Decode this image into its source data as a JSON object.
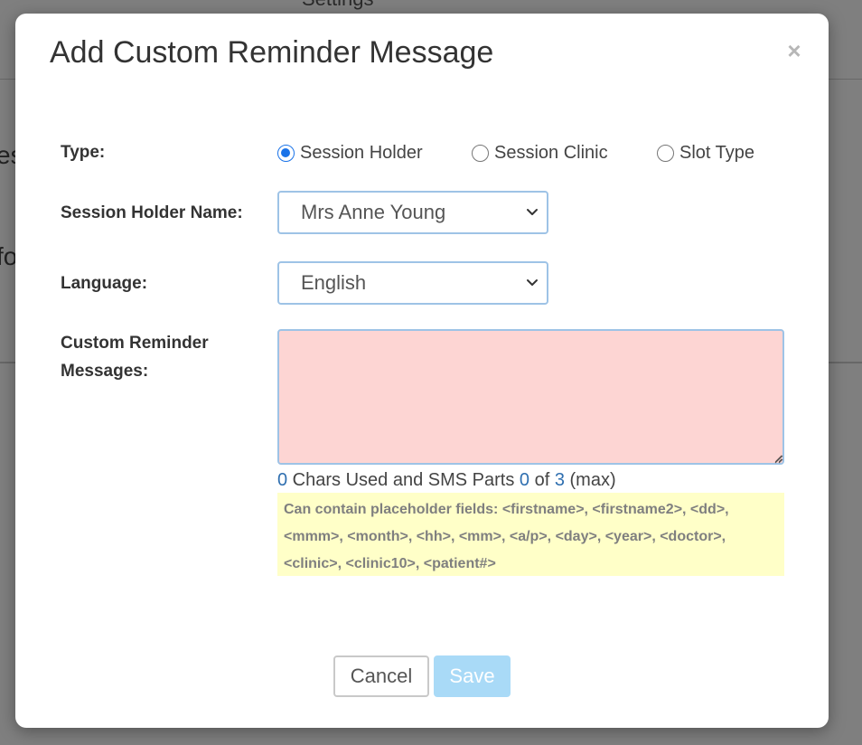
{
  "background": {
    "header_text": "Settings",
    "fragment_1": "es",
    "fragment_2": "fo"
  },
  "modal": {
    "title": "Add Custom Reminder Message",
    "close_glyph": "×"
  },
  "form": {
    "type_label": "Type:",
    "type_options": [
      {
        "label": "Session Holder",
        "checked": true
      },
      {
        "label": "Session Clinic",
        "checked": false
      },
      {
        "label": "Slot Type",
        "checked": false
      }
    ],
    "holder_label": "Session Holder Name:",
    "holder_value": "Mrs Anne Young",
    "language_label": "Language:",
    "language_value": "English",
    "messages_label": "Custom Reminder Messages:",
    "messages_value": "",
    "counter": {
      "chars_used": "0",
      "chars_text": " Chars Used and SMS Parts ",
      "parts_used": "0",
      "of_text": " of ",
      "parts_max": "3",
      "max_text": " (max)"
    },
    "hint": "Can contain placeholder fields: <firstname>, <firstname2>, <dd>, <mmm>, <month>, <hh>, <mm>, <a/p>, <day>, <year>, <doctor>, <clinic>, <clinic10>, <patient#>"
  },
  "buttons": {
    "cancel": "Cancel",
    "save": "Save"
  },
  "colors": {
    "accent": "#1a73e8",
    "textarea_invalid_bg": "#fdd5d3",
    "hint_bg": "#ffffc8",
    "save_disabled_bg": "#a9daf7",
    "counter_number": "#2f6fb0"
  }
}
